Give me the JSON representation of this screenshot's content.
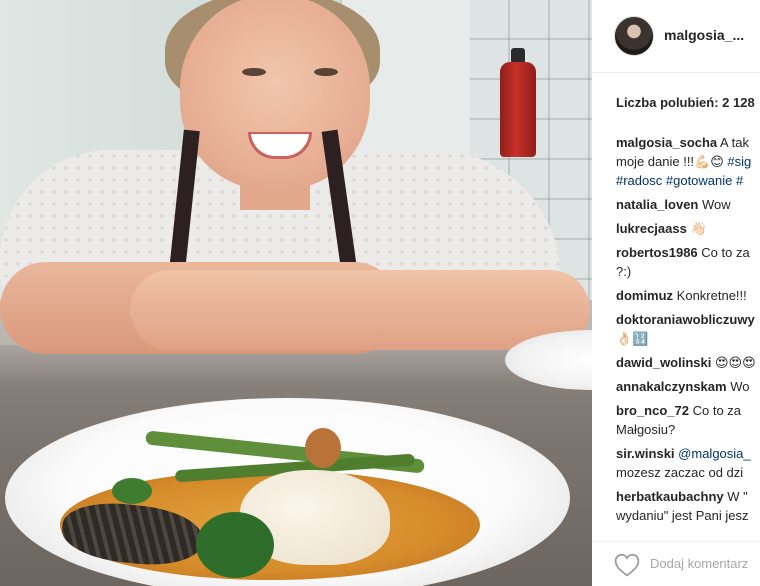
{
  "post": {
    "username": "malgosia_...",
    "likes": "Liczba polubień: 2 128",
    "comments": [
      {
        "user": "malgosia_socha",
        "lines": [
          [
            {
              "t": "text",
              "v": " A tak"
            }
          ],
          [
            {
              "t": "text",
              "v": "moje danie !!!💪🏻😊 "
            },
            {
              "t": "tag",
              "v": "#sig"
            }
          ],
          [
            {
              "t": "tag",
              "v": "#radosc"
            },
            {
              "t": "text",
              "v": " "
            },
            {
              "t": "tag",
              "v": "#gotowanie"
            },
            {
              "t": "text",
              "v": " "
            },
            {
              "t": "tag",
              "v": "#"
            }
          ]
        ]
      },
      {
        "user": "natalia_loven",
        "lines": [
          [
            {
              "t": "text",
              "v": " Wow"
            }
          ]
        ]
      },
      {
        "user": "lukrecjaass",
        "lines": [
          [
            {
              "t": "text",
              "v": " 👋🏻"
            }
          ]
        ]
      },
      {
        "user": "robertos1986",
        "lines": [
          [
            {
              "t": "text",
              "v": " Co to za"
            }
          ],
          [
            {
              "t": "text",
              "v": "?:)"
            }
          ]
        ]
      },
      {
        "user": "domimuz",
        "lines": [
          [
            {
              "t": "text",
              "v": " Konkretne!!!"
            }
          ]
        ]
      },
      {
        "user": "doktoraniawobliczuwy",
        "lines": [
          [
            {
              "t": "text",
              "v": ""
            }
          ],
          [
            {
              "t": "text",
              "v": "👌🏻🔢"
            }
          ]
        ]
      },
      {
        "user": "dawid_wolinski",
        "lines": [
          [
            {
              "t": "text",
              "v": " 😍😍😍"
            }
          ]
        ]
      },
      {
        "user": "annakalczynskam",
        "lines": [
          [
            {
              "t": "text",
              "v": " Wo"
            }
          ]
        ]
      },
      {
        "user": "bro_nco_72",
        "lines": [
          [
            {
              "t": "text",
              "v": " Co to za"
            }
          ],
          [
            {
              "t": "text",
              "v": "Małgosiu?"
            }
          ]
        ]
      },
      {
        "user": "sir.winski",
        "lines": [
          [
            {
              "t": "text",
              "v": " "
            },
            {
              "t": "tag",
              "v": "@malgosia_"
            }
          ],
          [
            {
              "t": "text",
              "v": "mozesz zaczac od dzi"
            }
          ]
        ]
      },
      {
        "user": "herbatkaubachny",
        "lines": [
          [
            {
              "t": "text",
              "v": " W \""
            }
          ],
          [
            {
              "t": "text",
              "v": "wydaniu\" jest Pani jesz"
            }
          ]
        ]
      }
    ],
    "add_comment_placeholder": "Dodaj komentarz"
  },
  "colors": {
    "link": "#003569",
    "text": "#262626",
    "muted": "#a7a7a7"
  }
}
